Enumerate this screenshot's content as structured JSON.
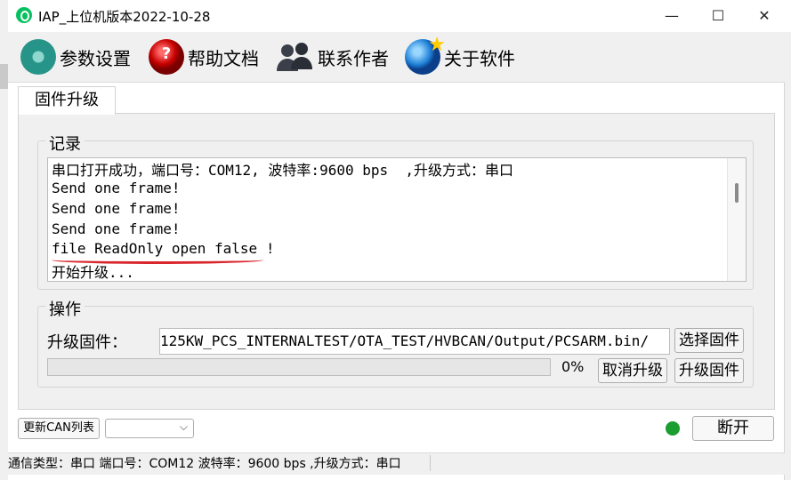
{
  "window": {
    "title": "IAP_上位机版本2022-10-28",
    "minimize": "—",
    "maximize": "☐",
    "close": "✕"
  },
  "menu": [
    {
      "label": "参数设置",
      "icon": "gear-icon"
    },
    {
      "label": "帮助文档",
      "icon": "help-icon",
      "icon_text": "?"
    },
    {
      "label": "联系作者",
      "icon": "contacts-icon"
    },
    {
      "label": "关于软件",
      "icon": "globe-star-icon"
    }
  ],
  "tab": {
    "label": "固件升级"
  },
  "log": {
    "title": "记录",
    "lines": [
      "串口打开成功，端口号：COM12, 波特率:9600 bps  ,升级方式：串口",
      "Send one frame!",
      "Send one frame!",
      "Send one frame!",
      "file ReadOnly open false !",
      "开始升级..."
    ]
  },
  "operation": {
    "title": "操作",
    "firmware_label": "升级固件：",
    "firmware_path": "/125KW_PCS_INTERNALTEST/OTA_TEST/HVBCAN/Output/PCSARM.bin",
    "select_button": "选择固件",
    "progress_value": 0,
    "progress_text": "0%",
    "cancel_button": "取消升级",
    "upgrade_button": "升级固件"
  },
  "bottom": {
    "refresh_button": "更新CAN列表",
    "combo_value": "",
    "disconnect_button": "断开",
    "status_led_color": "#1a9e2f"
  },
  "statusbar": {
    "text": "通信类型：串口 端口号：COM12  波特率：9600 bps ,升级方式：串口"
  },
  "colors": {
    "underline": "#d9262c",
    "progress_fill": "#06b025"
  }
}
